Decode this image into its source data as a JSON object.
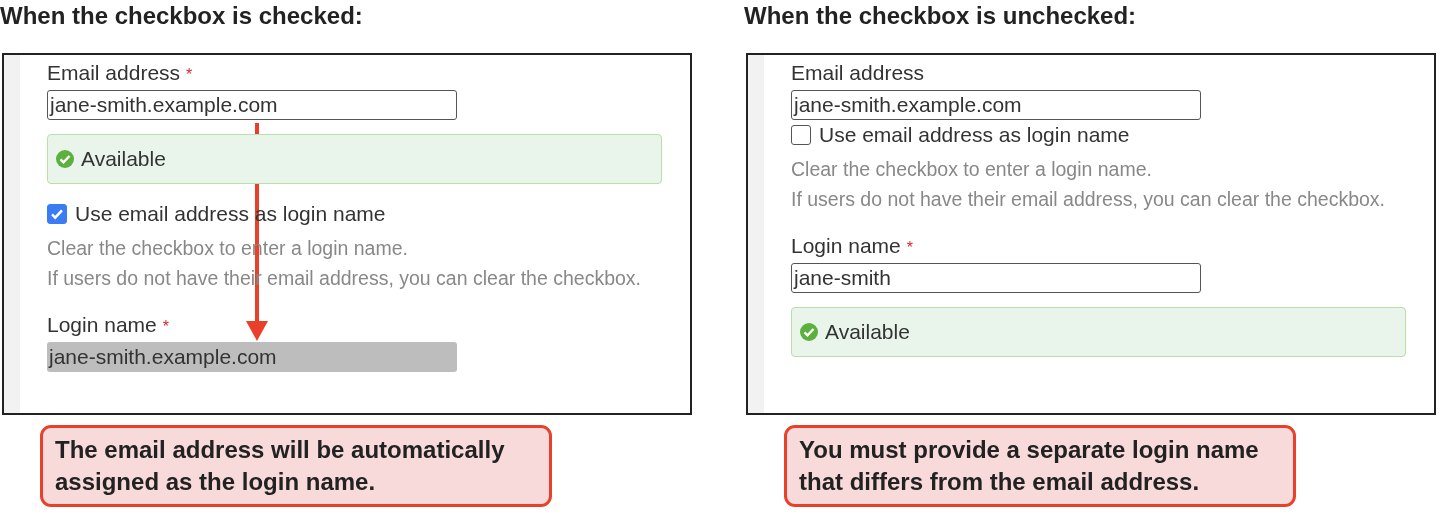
{
  "panels": [
    {
      "heading": "When the checkbox is checked:",
      "arrow": true,
      "items": [
        {
          "kind": "field",
          "label": "Email address",
          "required_mark": "*",
          "value": "jane-smith.example.com",
          "disabled": false
        },
        {
          "kind": "status",
          "text": "Available"
        },
        {
          "kind": "checkbox",
          "label": "Use email address as login name",
          "checked": true
        },
        {
          "kind": "hint",
          "lines": [
            "Clear the checkbox to enter a login name.",
            "If users do not have their email address, you can clear the checkbox."
          ]
        },
        {
          "kind": "field",
          "label": "Login name",
          "required_mark": "*",
          "value": "jane-smith.example.com",
          "disabled": true
        }
      ],
      "callout": "The email address will be automatically assigned as the login name."
    },
    {
      "heading": "When the checkbox is unchecked:",
      "arrow": false,
      "items": [
        {
          "kind": "field",
          "label": "Email address",
          "value": "jane-smith.example.com",
          "disabled": false
        },
        {
          "kind": "checkbox",
          "label": "Use email address as login name",
          "checked": false
        },
        {
          "kind": "hint",
          "lines": [
            "Clear the checkbox to enter a login name.",
            "If users do not have their email address, you can clear the checkbox."
          ]
        },
        {
          "kind": "field",
          "label": "Login name",
          "required_mark": "*",
          "value": "jane-smith",
          "disabled": false
        },
        {
          "kind": "status",
          "text": "Available"
        }
      ],
      "callout": "You must provide a separate login name that differs from the email address."
    }
  ]
}
